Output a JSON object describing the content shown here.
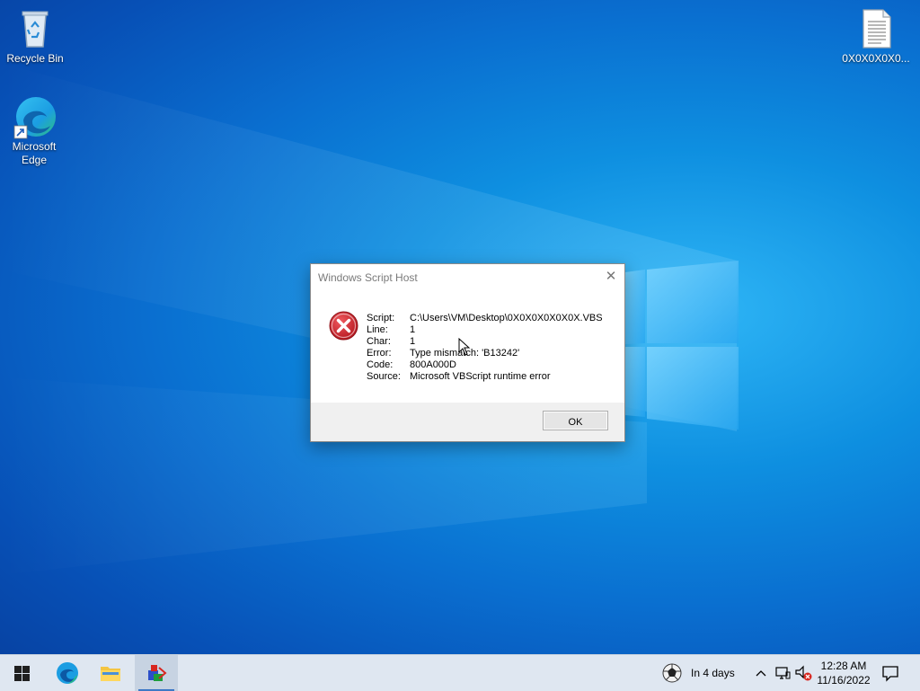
{
  "desktop": {
    "icons": [
      {
        "label": "Recycle Bin"
      },
      {
        "label": "Microsoft Edge"
      },
      {
        "label": "0X0X0X0X0..."
      }
    ]
  },
  "dialog": {
    "title": "Windows Script Host",
    "fields": [
      {
        "key": "Script:",
        "value": "C:\\Users\\VM\\Desktop\\0X0X0X0X0X0X.VBS"
      },
      {
        "key": "Line:",
        "value": "1"
      },
      {
        "key": "Char:",
        "value": "1"
      },
      {
        "key": "Error:",
        "value": "Type mismatch: 'B13242'"
      },
      {
        "key": "Code:",
        "value": "800A000D"
      },
      {
        "key": "Source:",
        "value": "Microsoft VBScript runtime error"
      }
    ],
    "ok_label": "OK",
    "close_glyph": "✕"
  },
  "taskbar": {
    "weather_text": "In 4 days",
    "clock_time": "12:28 AM",
    "clock_date": "11/16/2022"
  },
  "colors": {
    "taskbar_bg": "#dfe7f1",
    "error_red": "#c8262e",
    "accent": "#0078d7"
  }
}
